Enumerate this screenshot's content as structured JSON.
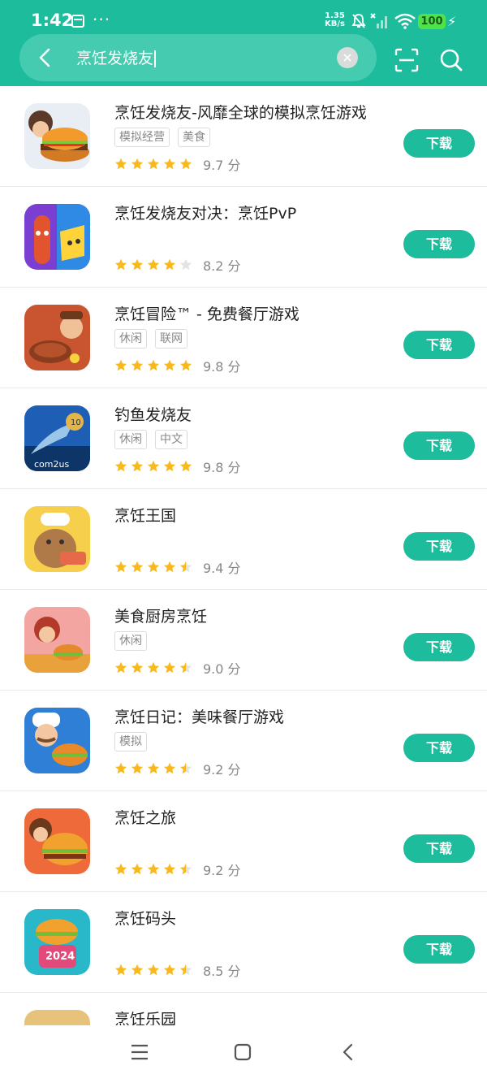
{
  "status_bar": {
    "time": "1:42",
    "dots": "···",
    "net_speed_value": "1.35",
    "net_speed_unit": "KB/s",
    "battery": "100"
  },
  "search": {
    "query": "烹饪发烧友"
  },
  "download_label": "下载",
  "score_unit": "分",
  "apps": [
    {
      "name": "烹饪发烧友-风靡全球的模拟烹饪游戏",
      "tags": [
        "模拟经营",
        "美食"
      ],
      "rating": "9.7",
      "stars": 5
    },
    {
      "name": "烹饪发烧友对决：烹饪PvP",
      "tags": [],
      "rating": "8.2",
      "stars": 4
    },
    {
      "name": "烹饪冒险™ - 免费餐厅游戏",
      "tags": [
        "休闲",
        "联网"
      ],
      "rating": "9.8",
      "stars": 5
    },
    {
      "name": "钓鱼发烧友",
      "tags": [
        "休闲",
        "中文"
      ],
      "rating": "9.8",
      "stars": 5
    },
    {
      "name": "烹饪王国",
      "tags": [],
      "rating": "9.4",
      "stars": 4.5
    },
    {
      "name": "美食厨房烹饪",
      "tags": [
        "休闲"
      ],
      "rating": "9.0",
      "stars": 4.5
    },
    {
      "name": "烹饪日记：美味餐厅游戏",
      "tags": [
        "模拟"
      ],
      "rating": "9.2",
      "stars": 4.5
    },
    {
      "name": "烹饪之旅",
      "tags": [],
      "rating": "9.2",
      "stars": 4.5
    },
    {
      "name": "烹饪码头",
      "tags": [],
      "rating": "8.5",
      "stars": 4.5
    },
    {
      "name": "烹饪乐园",
      "tags": [],
      "rating": "",
      "stars": 0
    }
  ],
  "colors": {
    "accent": "#1cbc9c",
    "star": "#f9b91c",
    "star_empty": "#e3e3e3"
  }
}
